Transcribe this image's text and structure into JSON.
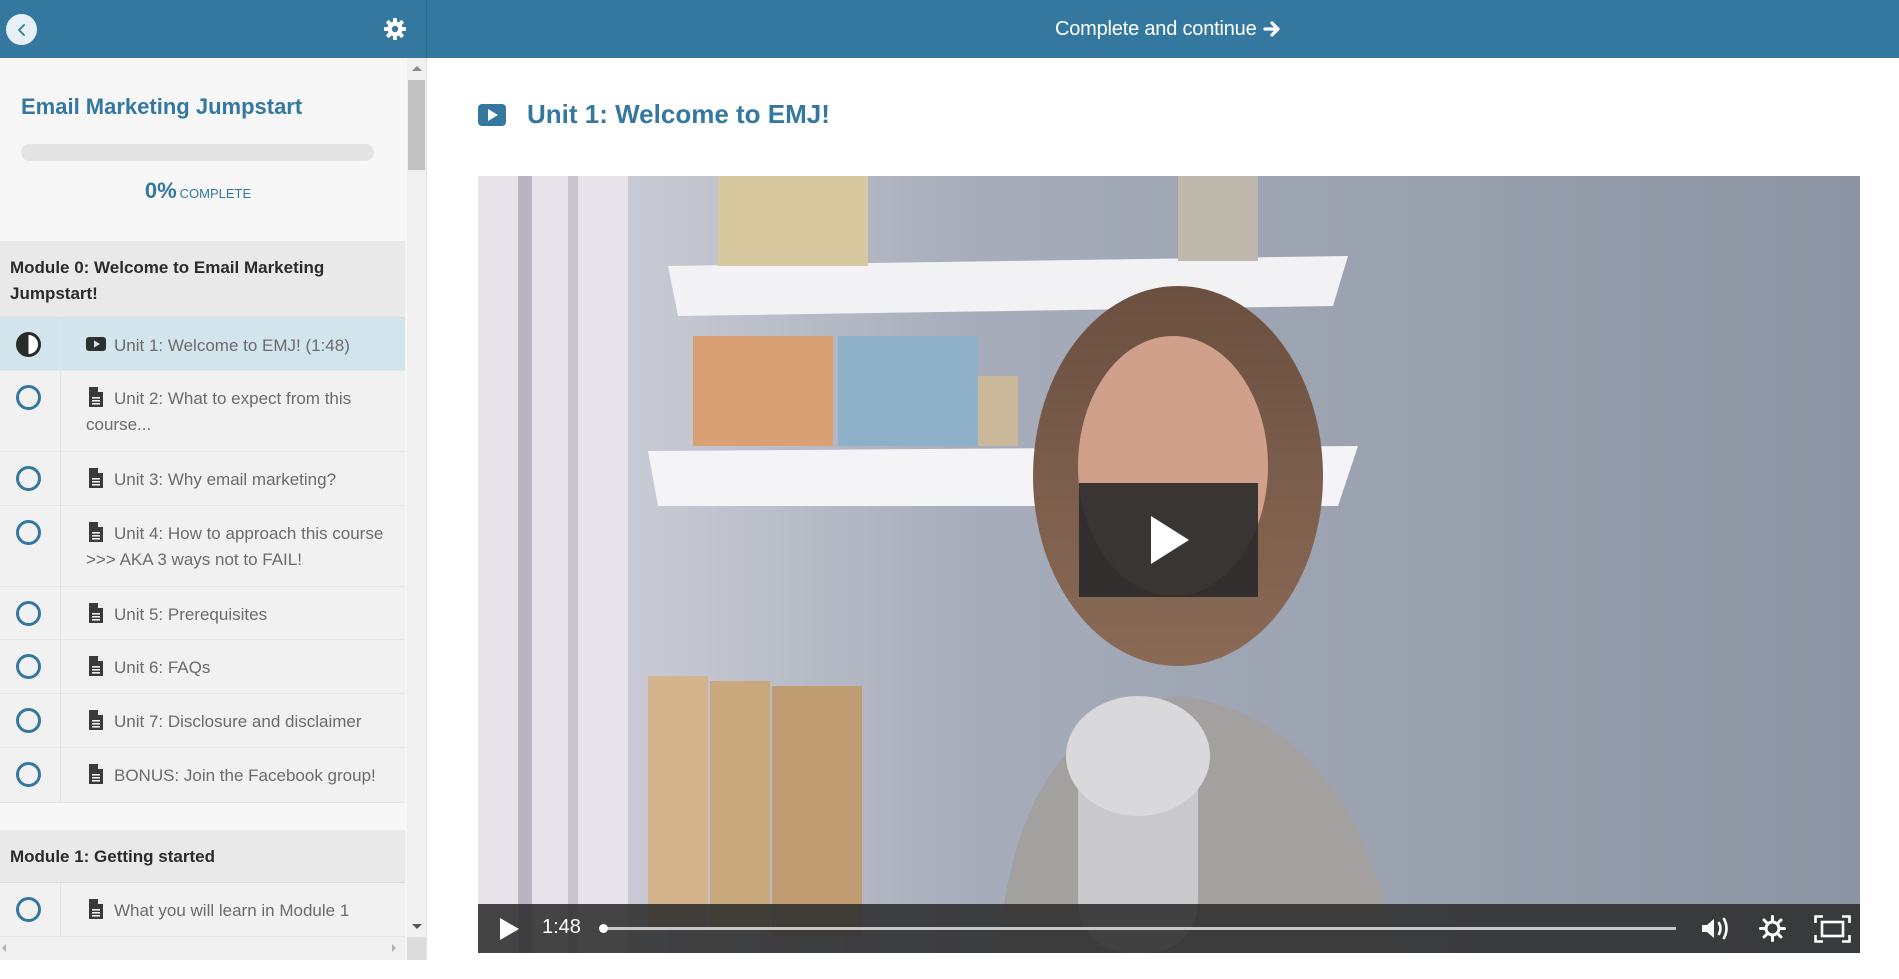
{
  "sidebar": {
    "back_icon": "chevron-left-icon",
    "settings_icon": "gear-icon",
    "course_title": "Email Marketing Jumpstart",
    "progress": {
      "percent_value": 0,
      "percent_text": "0%",
      "label": "COMPLETE"
    },
    "modules": [
      {
        "title": "Module 0: Welcome to Email Marketing Jumpstart!",
        "units": [
          {
            "label": "Unit 1: Welcome to EMJ! (1:48)",
            "type": "video",
            "status": "in-progress",
            "active": true
          },
          {
            "label": "Unit 2: What to expect from this course...",
            "type": "document",
            "status": "not-started",
            "active": false
          },
          {
            "label": "Unit 3: Why email marketing?",
            "type": "document",
            "status": "not-started",
            "active": false
          },
          {
            "label": "Unit 4: How to approach this course >>> AKA 3 ways not to FAIL!",
            "type": "document",
            "status": "not-started",
            "active": false
          },
          {
            "label": "Unit 5: Prerequisites",
            "type": "document",
            "status": "not-started",
            "active": false
          },
          {
            "label": "Unit 6: FAQs",
            "type": "document",
            "status": "not-started",
            "active": false
          },
          {
            "label": "Unit 7: Disclosure and disclaimer",
            "type": "document",
            "status": "not-started",
            "active": false
          },
          {
            "label": "BONUS: Join the Facebook group!",
            "type": "document",
            "status": "not-started",
            "active": false
          }
        ]
      },
      {
        "title": "Module 1: Getting started",
        "units": [
          {
            "label": "What you will learn in Module 1",
            "type": "document",
            "status": "not-started",
            "active": false
          }
        ]
      }
    ]
  },
  "header": {
    "complete_button_label": "Complete and continue",
    "complete_button_icon": "arrow-right-icon"
  },
  "lesson": {
    "title": "Unit 1: Welcome to EMJ!",
    "icon": "video-play-icon"
  },
  "video": {
    "state": "paused",
    "time_display": "1:48",
    "played_fraction": 0,
    "controls": [
      "play",
      "volume",
      "settings",
      "fullscreen"
    ]
  },
  "colors": {
    "brand": "#35789f",
    "active_row": "#d3e5ec",
    "module_header_bg": "#e9e9e9"
  }
}
